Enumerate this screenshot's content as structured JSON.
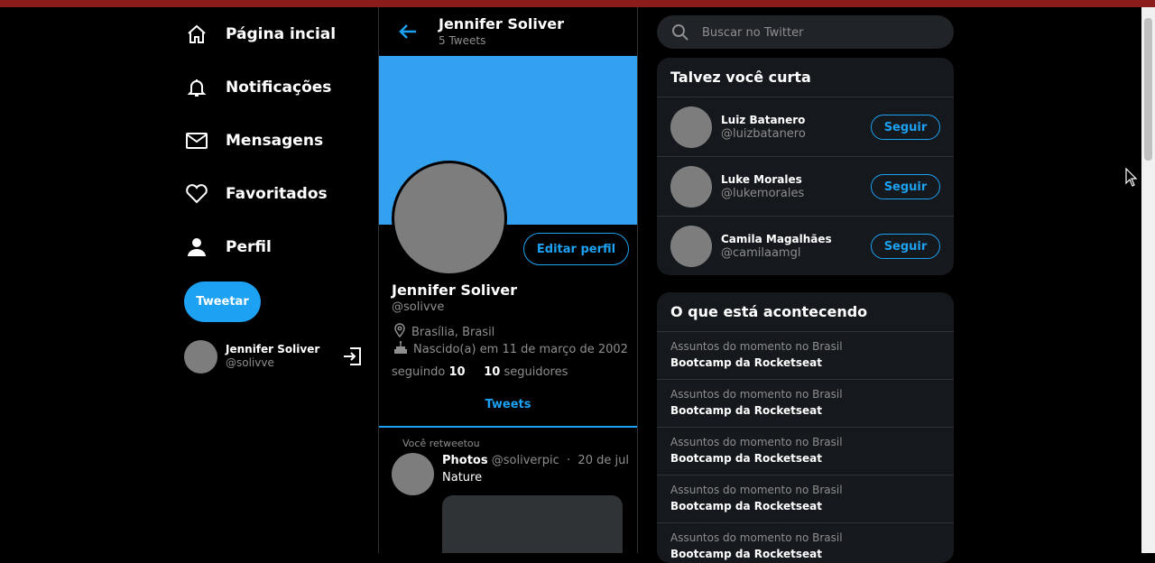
{
  "nav": {
    "items": [
      {
        "label": "Página incial",
        "icon": "home-icon"
      },
      {
        "label": "Notificações",
        "icon": "bell-icon"
      },
      {
        "label": "Mensagens",
        "icon": "mail-icon"
      },
      {
        "label": "Favoritados",
        "icon": "heart-icon"
      },
      {
        "label": "Perfil",
        "icon": "user-icon"
      }
    ],
    "tweet_button": "Tweetar",
    "user": {
      "name": "Jennifer Soliver",
      "handle": "@solivve",
      "logout_icon": "logout-icon"
    }
  },
  "profile": {
    "header_name": "Jennifer Soliver",
    "tweet_count": "5 Tweets",
    "edit_button": "Editar perfil",
    "name": "Jennifer Soliver",
    "handle": "@solivve",
    "location": "Brasília, Brasil",
    "birth": "Nascido(a) em 11 de março de 2002",
    "following_label": "seguindo",
    "following_count": "10",
    "followers_count": "10",
    "followers_label": "seguidores",
    "tab": "Tweets",
    "banner_color": "#34a1f0"
  },
  "tweet": {
    "retweet_label": "Você retweetou",
    "author": "Photos",
    "handle": "@soliverpic",
    "separator": "·",
    "date": "20 de jul",
    "text": "Nature"
  },
  "search": {
    "placeholder": "Buscar no Twitter"
  },
  "who_to_follow": {
    "title": "Talvez você curta",
    "follow_label": "Seguir",
    "users": [
      {
        "name": "Luiz Batanero",
        "handle": "@luizbatanero"
      },
      {
        "name": "Luke Morales",
        "handle": "@lukemorales"
      },
      {
        "name": "Camila Magalhães",
        "handle": "@camilaamgl"
      }
    ]
  },
  "trends": {
    "title": "O que está acontecendo",
    "items": [
      {
        "context": "Assuntos do momento no Brasil",
        "topic": "Bootcamp da Rocketseat"
      },
      {
        "context": "Assuntos do momento no Brasil",
        "topic": "Bootcamp da Rocketseat"
      },
      {
        "context": "Assuntos do momento no Brasil",
        "topic": "Bootcamp da Rocketseat"
      },
      {
        "context": "Assuntos do momento no Brasil",
        "topic": "Bootcamp da Rocketseat"
      },
      {
        "context": "Assuntos do momento no Brasil",
        "topic": "Bootcamp da Rocketseat"
      }
    ]
  },
  "colors": {
    "accent": "#1da1f2",
    "background": "#000000",
    "card": "#15181c"
  }
}
